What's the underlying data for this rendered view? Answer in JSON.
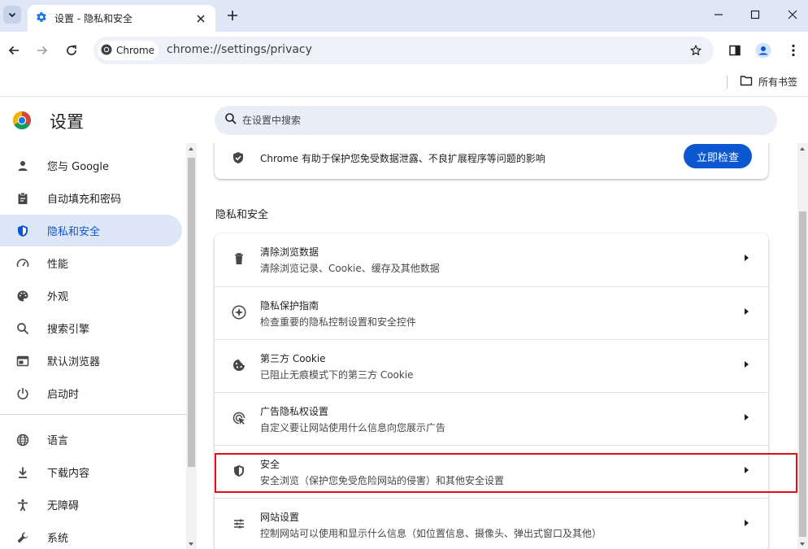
{
  "browser": {
    "tab_title": "设置 - 隐私和安全",
    "chip_label": "Chrome",
    "url": "chrome://settings/privacy",
    "bookmarks_folder": "所有书签"
  },
  "icons": {
    "tab_search": "chevron-down-icon",
    "tab_favicon": "gear-icon",
    "tab_close": "close-icon",
    "new_tab": "plus-icon",
    "minimize": "minimize-icon",
    "maximize": "maximize-icon",
    "close_window": "close-icon",
    "back": "back-arrow-icon",
    "forward": "forward-arrow-icon",
    "reload": "reload-icon",
    "bookmark_star": "star-icon",
    "side_panel": "side-panel-icon",
    "profile": "profile-icon",
    "menu": "kebab-menu-icon",
    "folder": "folder-icon",
    "search": "search-icon"
  },
  "settings": {
    "title": "设置",
    "search_placeholder": "在设置中搜索"
  },
  "sidebar": {
    "items": [
      {
        "label": "您与 Google",
        "icon": "person-icon"
      },
      {
        "label": "自动填充和密码",
        "icon": "clipboard-icon"
      },
      {
        "label": "隐私和安全",
        "icon": "shield-icon",
        "active": true
      },
      {
        "label": "性能",
        "icon": "speedometer-icon"
      },
      {
        "label": "外观",
        "icon": "palette-icon"
      },
      {
        "label": "搜索引擎",
        "icon": "search-icon"
      },
      {
        "label": "默认浏览器",
        "icon": "browser-window-icon"
      },
      {
        "label": "启动时",
        "icon": "power-icon"
      },
      {
        "label": "语言",
        "icon": "globe-icon"
      },
      {
        "label": "下载内容",
        "icon": "download-icon"
      },
      {
        "label": "无障碍",
        "icon": "accessibility-icon"
      },
      {
        "label": "系统",
        "icon": "wrench-icon"
      }
    ]
  },
  "safety_check": {
    "text": "Chrome 有助于保护您免受数据泄露、不良扩展程序等问题的影响",
    "button": "立即检查"
  },
  "privacy": {
    "section_title": "隐私和安全",
    "rows": [
      {
        "title": "清除浏览数据",
        "subtitle": "清除浏览记录、Cookie、缓存及其他数据",
        "icon": "trash-icon"
      },
      {
        "title": "隐私保护指南",
        "subtitle": "检查重要的隐私控制设置和安全控件",
        "icon": "compass-icon"
      },
      {
        "title": "第三方 Cookie",
        "subtitle": "已阻止无痕模式下的第三方 Cookie",
        "icon": "cookie-icon"
      },
      {
        "title": "广告隐私权设置",
        "subtitle": "自定义要让网站使用什么信息向您展示广告",
        "icon": "ad-privacy-icon"
      },
      {
        "title": "安全",
        "subtitle": "安全浏览（保护您免受危险网站的侵害）和其他安全设置",
        "icon": "shield-half-icon"
      },
      {
        "title": "网站设置",
        "subtitle": "控制网站可以使用和显示什么信息（如位置信息、摄像头、弹出式窗口及其他）",
        "icon": "tune-icon"
      }
    ]
  },
  "colors": {
    "accent": "#0b57d0",
    "highlight_border": "#e0101a",
    "tabbar": "#dfe6f5"
  }
}
